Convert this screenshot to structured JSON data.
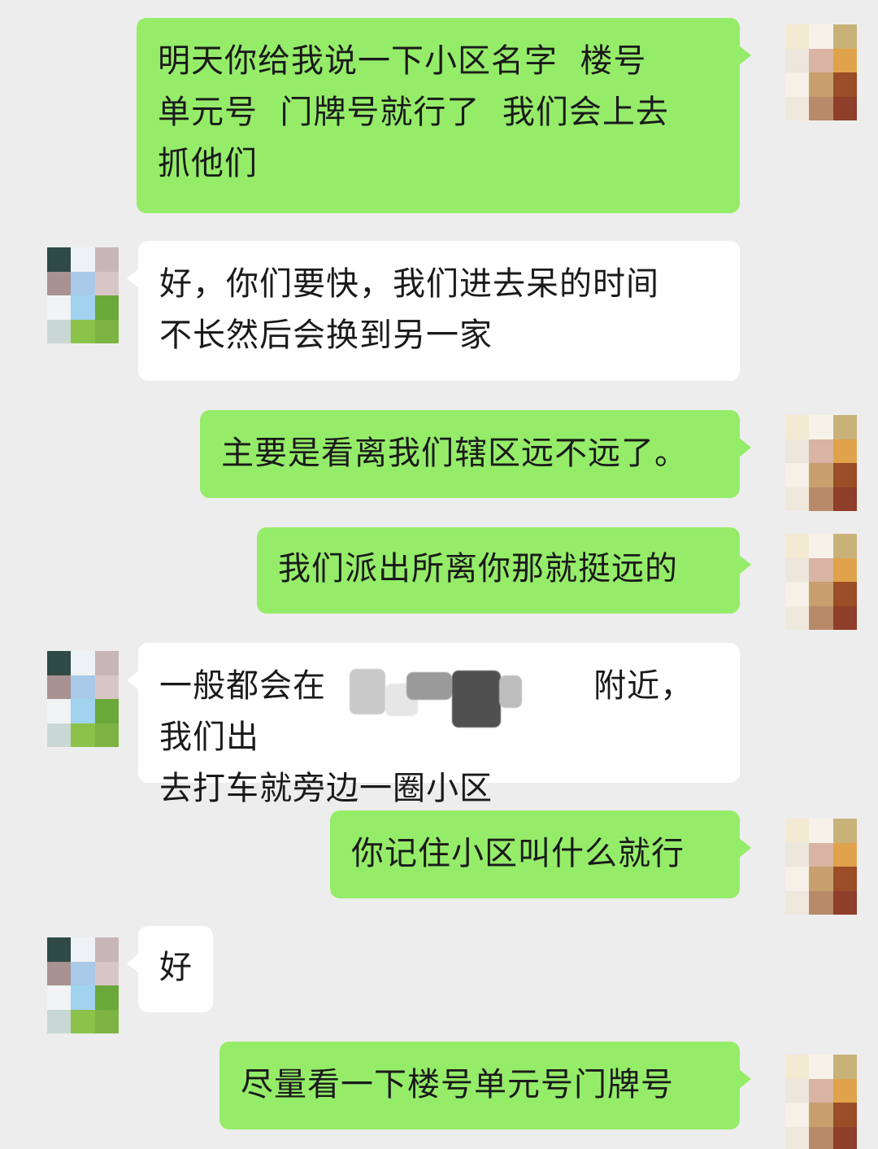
{
  "chat": {
    "messages": [
      {
        "side": "sent",
        "text": "明天你给我说一下小区名字  楼号\n单元号  门牌号就行了  我们会上去\n抓他们"
      },
      {
        "side": "received",
        "text": "好，你们要快，我们进去呆的时间\n不长然后会换到另一家"
      },
      {
        "side": "sent",
        "text": "主要是看离我们辖区远不远了。"
      },
      {
        "side": "sent",
        "text": "我们派出所离你那就挺远的"
      },
      {
        "side": "received",
        "text": "一般都会在                        附近，我们出\n去打车就旁边一圈小区"
      },
      {
        "side": "sent",
        "text": "你记住小区叫什么就行"
      },
      {
        "side": "received",
        "text": "好"
      },
      {
        "side": "sent",
        "text": "尽量看一下楼号单元号门牌号"
      }
    ]
  },
  "colors": {
    "background": "#ededed",
    "sent_bubble": "#95ec69",
    "received_bubble": "#ffffff",
    "text": "#1a1a1a"
  },
  "avatars": {
    "sent_palette": [
      "#f3ead3",
      "#f6f2ea",
      "#c9b27a",
      "#ece6dc",
      "#d9b3a3",
      "#e0a24a",
      "#f5f0e8",
      "#c8a06e",
      "#9b4d26",
      "#efe9dd",
      "#b88a6a",
      "#8e3e2a"
    ],
    "received_palette": [
      "#2f4a44",
      "#eef2f4",
      "#c8b6b6",
      "#a89292",
      "#a9c9e8",
      "#d8c6c6",
      "#f1f3f4",
      "#9fd3ee",
      "#6aa83a",
      "#c9d8d4",
      "#8bc34a",
      "#7cb342"
    ]
  }
}
